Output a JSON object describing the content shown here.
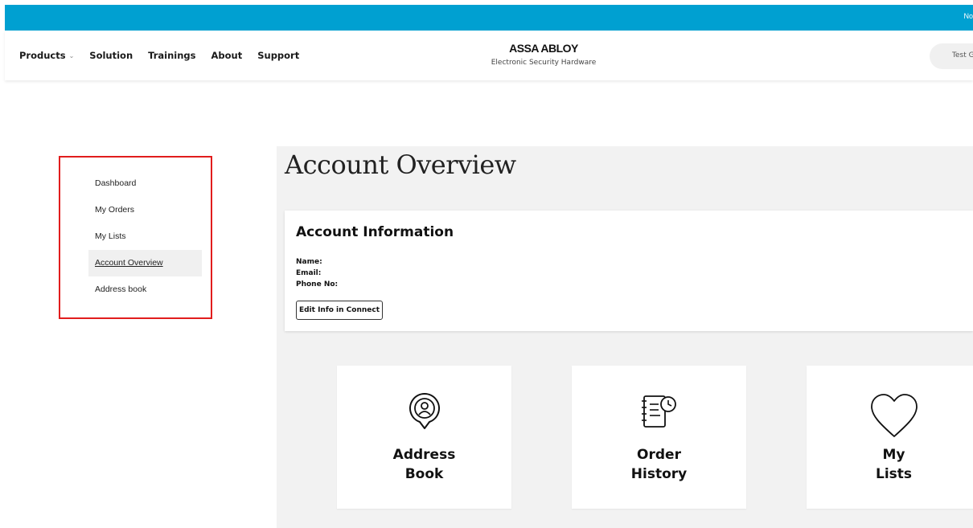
{
  "topbar": {
    "text": "No"
  },
  "nav": {
    "products": "Products",
    "solution": "Solution",
    "trainings": "Trainings",
    "about": "About",
    "support": "Support"
  },
  "brand": {
    "logo": "ASSA ABLOY",
    "subtitle": "Electronic Security Hardware"
  },
  "user": {
    "label": "Test Globa"
  },
  "sidebar": {
    "items": [
      {
        "label": "Dashboard"
      },
      {
        "label": "My Orders"
      },
      {
        "label": "My Lists"
      },
      {
        "label": "Account Overview",
        "active": true
      },
      {
        "label": "Address book"
      }
    ]
  },
  "main": {
    "title": "Account Overview",
    "account_info": {
      "heading": "Account Information",
      "name_label": "Name:",
      "email_label": "Email:",
      "phone_label": "Phone No:",
      "edit_button": "Edit Info in Connect"
    },
    "tiles": [
      {
        "line1": "Address",
        "line2": "Book",
        "icon": "address-pin-icon"
      },
      {
        "line1": "Order",
        "line2": "History",
        "icon": "order-history-icon"
      },
      {
        "line1": "My",
        "line2": "Lists",
        "icon": "heart-icon"
      }
    ]
  },
  "colors": {
    "topbar": "#00a0d1",
    "highlight_border": "#e11d1d",
    "main_bg": "#f2f2f2"
  }
}
